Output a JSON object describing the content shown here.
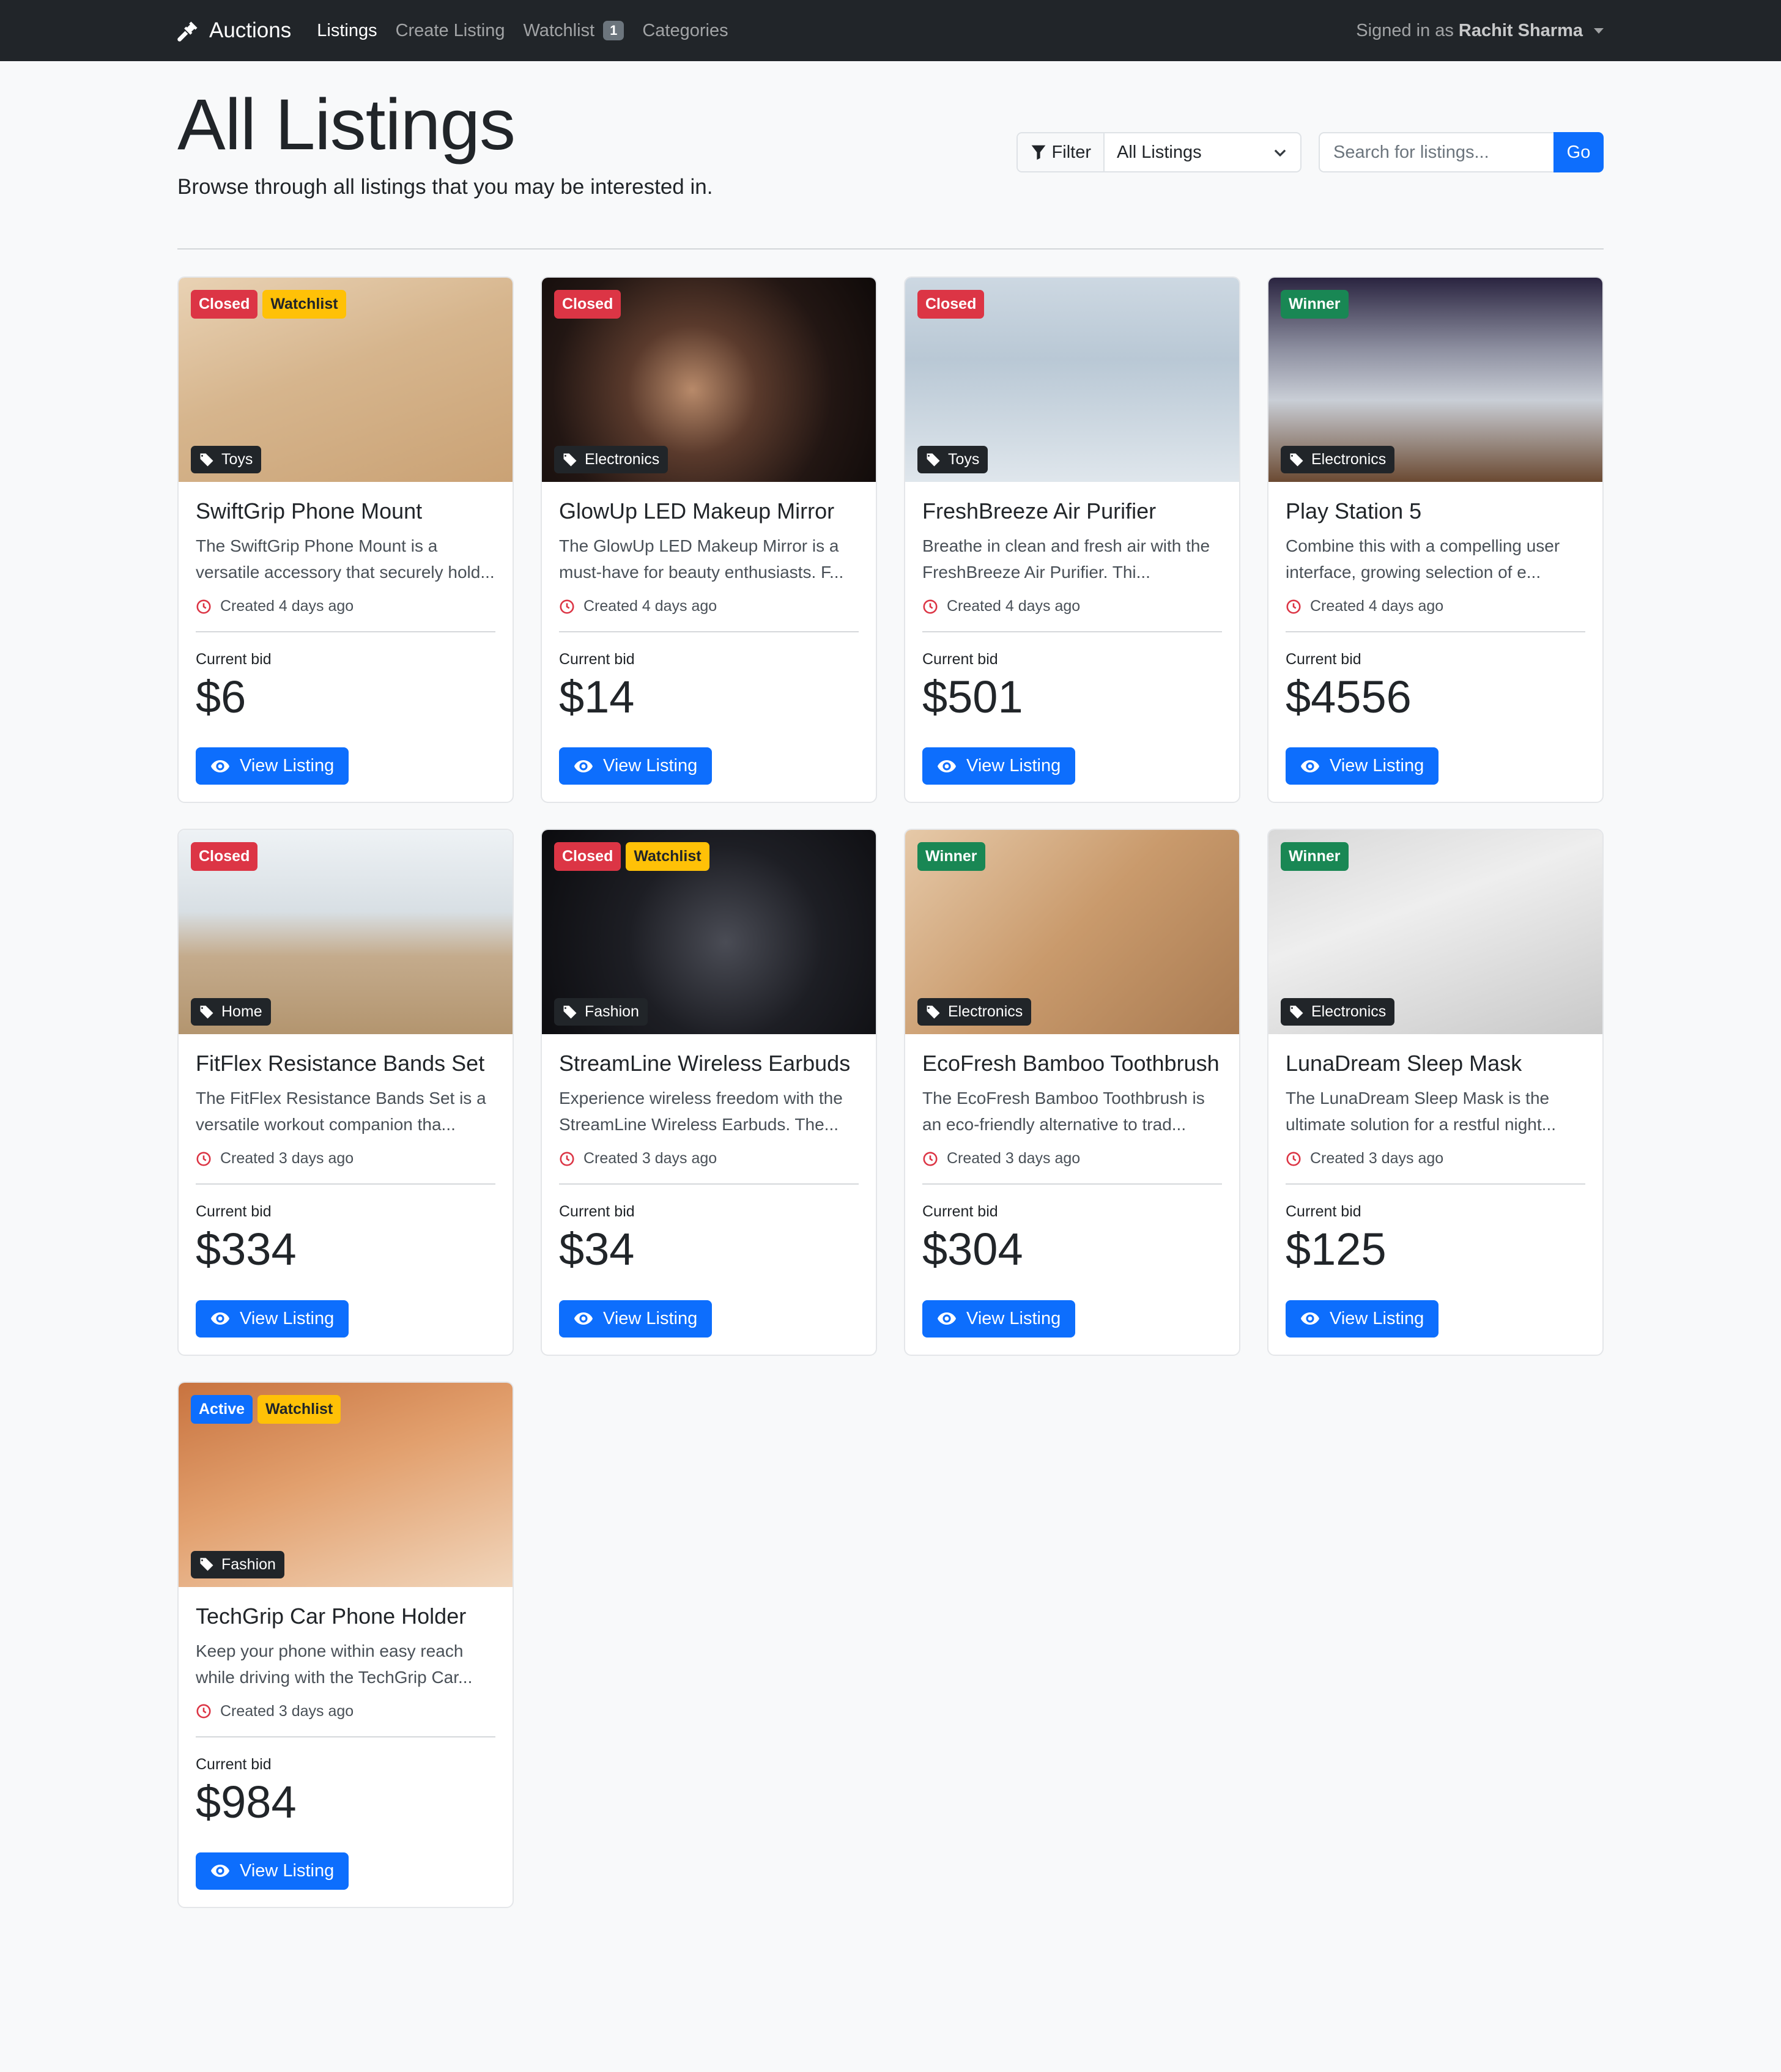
{
  "nav": {
    "brand": "Auctions",
    "links": [
      {
        "label": "Listings",
        "active": true
      },
      {
        "label": "Create Listing",
        "active": false
      },
      {
        "label": "Watchlist",
        "active": false,
        "badge": "1"
      },
      {
        "label": "Categories",
        "active": false
      }
    ],
    "signed_in_prefix": "Signed in as",
    "user_name": "Rachit Sharma"
  },
  "header": {
    "title": "All Listings",
    "subtitle": "Browse through all listings that you may be interested in.",
    "filter_label": "Filter",
    "filter_value": "All Listings",
    "search_placeholder": "Search for listings...",
    "go_label": "Go"
  },
  "labels": {
    "current_bid": "Current bid",
    "view_listing": "View Listing"
  },
  "colors": {
    "closed": "#dc3545",
    "winner": "#198754",
    "active": "#0d6efd",
    "watchlist": "#ffc107",
    "primary": "#0d6efd",
    "navbar": "#212529"
  },
  "listings": [
    {
      "title": "SwiftGrip Phone Mount",
      "description": "The SwiftGrip Phone Mount is a versatile accessory that securely hold...",
      "created": "Created 4 days ago",
      "bid": "$6",
      "status": "Closed",
      "watchlist": "Watchlist",
      "category": "Toys"
    },
    {
      "title": "GlowUp LED Makeup Mirror",
      "description": "The GlowUp LED Makeup Mirror is a must-have for beauty enthusiasts. F...",
      "created": "Created 4 days ago",
      "bid": "$14",
      "status": "Closed",
      "watchlist": null,
      "category": "Electronics"
    },
    {
      "title": "FreshBreeze Air Purifier",
      "description": "Breathe in clean and fresh air with the FreshBreeze Air Purifier. Thi...",
      "created": "Created 4 days ago",
      "bid": "$501",
      "status": "Closed",
      "watchlist": null,
      "category": "Toys"
    },
    {
      "title": "Play Station 5",
      "description": "Combine this with a compelling user interface, growing selection of e...",
      "created": "Created 4 days ago",
      "bid": "$4556",
      "status": "Winner",
      "watchlist": null,
      "category": "Electronics"
    },
    {
      "title": "FitFlex Resistance Bands Set",
      "description": "The FitFlex Resistance Bands Set is a versatile workout companion tha...",
      "created": "Created 3 days ago",
      "bid": "$334",
      "status": "Closed",
      "watchlist": null,
      "category": "Home"
    },
    {
      "title": "StreamLine Wireless Earbuds",
      "description": "Experience wireless freedom with the StreamLine Wireless Earbuds. The...",
      "created": "Created 3 days ago",
      "bid": "$34",
      "status": "Closed",
      "watchlist": "Watchlist",
      "category": "Fashion"
    },
    {
      "title": "EcoFresh Bamboo Toothbrush",
      "description": "The EcoFresh Bamboo Toothbrush is an eco-friendly alternative to trad...",
      "created": "Created 3 days ago",
      "bid": "$304",
      "status": "Winner",
      "watchlist": null,
      "category": "Electronics"
    },
    {
      "title": "LunaDream Sleep Mask",
      "description": "The LunaDream Sleep Mask is the ultimate solution for a restful night...",
      "created": "Created 3 days ago",
      "bid": "$125",
      "status": "Winner",
      "watchlist": null,
      "category": "Electronics"
    },
    {
      "title": "TechGrip Car Phone Holder",
      "description": "Keep your phone within easy reach while driving with the TechGrip Car...",
      "created": "Created 3 days ago",
      "bid": "$984",
      "status": "Active",
      "watchlist": "Watchlist",
      "category": "Fashion"
    }
  ]
}
